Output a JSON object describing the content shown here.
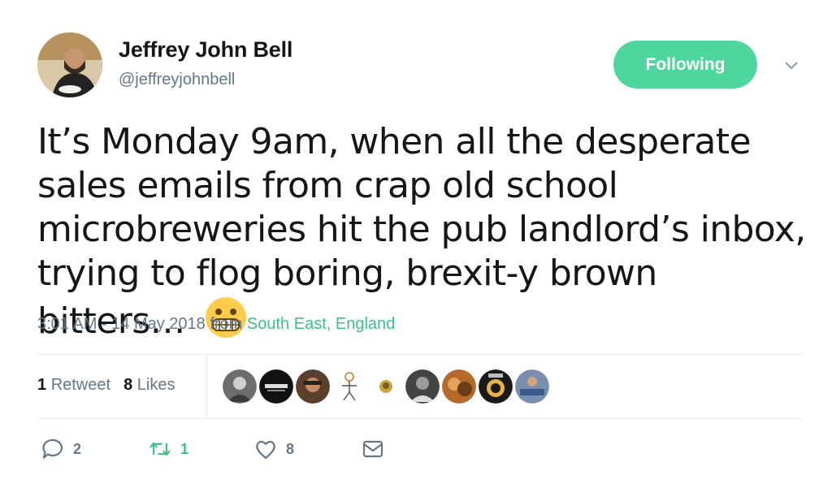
{
  "user": {
    "display_name": "Jeffrey John Bell",
    "handle": "@jeffreyjohnbell",
    "avatar_icon": "profile-photo"
  },
  "follow_button": {
    "label": "Following",
    "color": "#4fd59e"
  },
  "menu": {
    "icon": "chevron-down-icon"
  },
  "tweet": {
    "text": "It’s Monday 9am, when all the desperate sales emails from crap old school microbreweries hit the pub landlord’s inbox, trying to flog boring, brexit-y brown bitters… ",
    "emoji": "grimacing-face"
  },
  "meta": {
    "timestamp": "3:01 AM - 14 May 2018 from ",
    "location": "South East, England",
    "location_color": "#3fbf88"
  },
  "stats": {
    "retweet_count": "1",
    "retweet_label": "Retweet",
    "like_count": "8",
    "like_label": "Likes"
  },
  "likers": [
    {
      "name": "liker-avatar"
    },
    {
      "name": "liker-avatar"
    },
    {
      "name": "liker-avatar"
    },
    {
      "name": "liker-avatar"
    },
    {
      "name": "liker-avatar"
    },
    {
      "name": "liker-avatar"
    },
    {
      "name": "liker-avatar"
    },
    {
      "name": "liker-avatar"
    },
    {
      "name": "liker-avatar"
    }
  ],
  "actions": {
    "reply_count": "2",
    "retweet_count": "1",
    "like_count": "8",
    "icons": [
      "reply-icon",
      "retweet-icon",
      "heart-icon",
      "message-icon"
    ]
  }
}
